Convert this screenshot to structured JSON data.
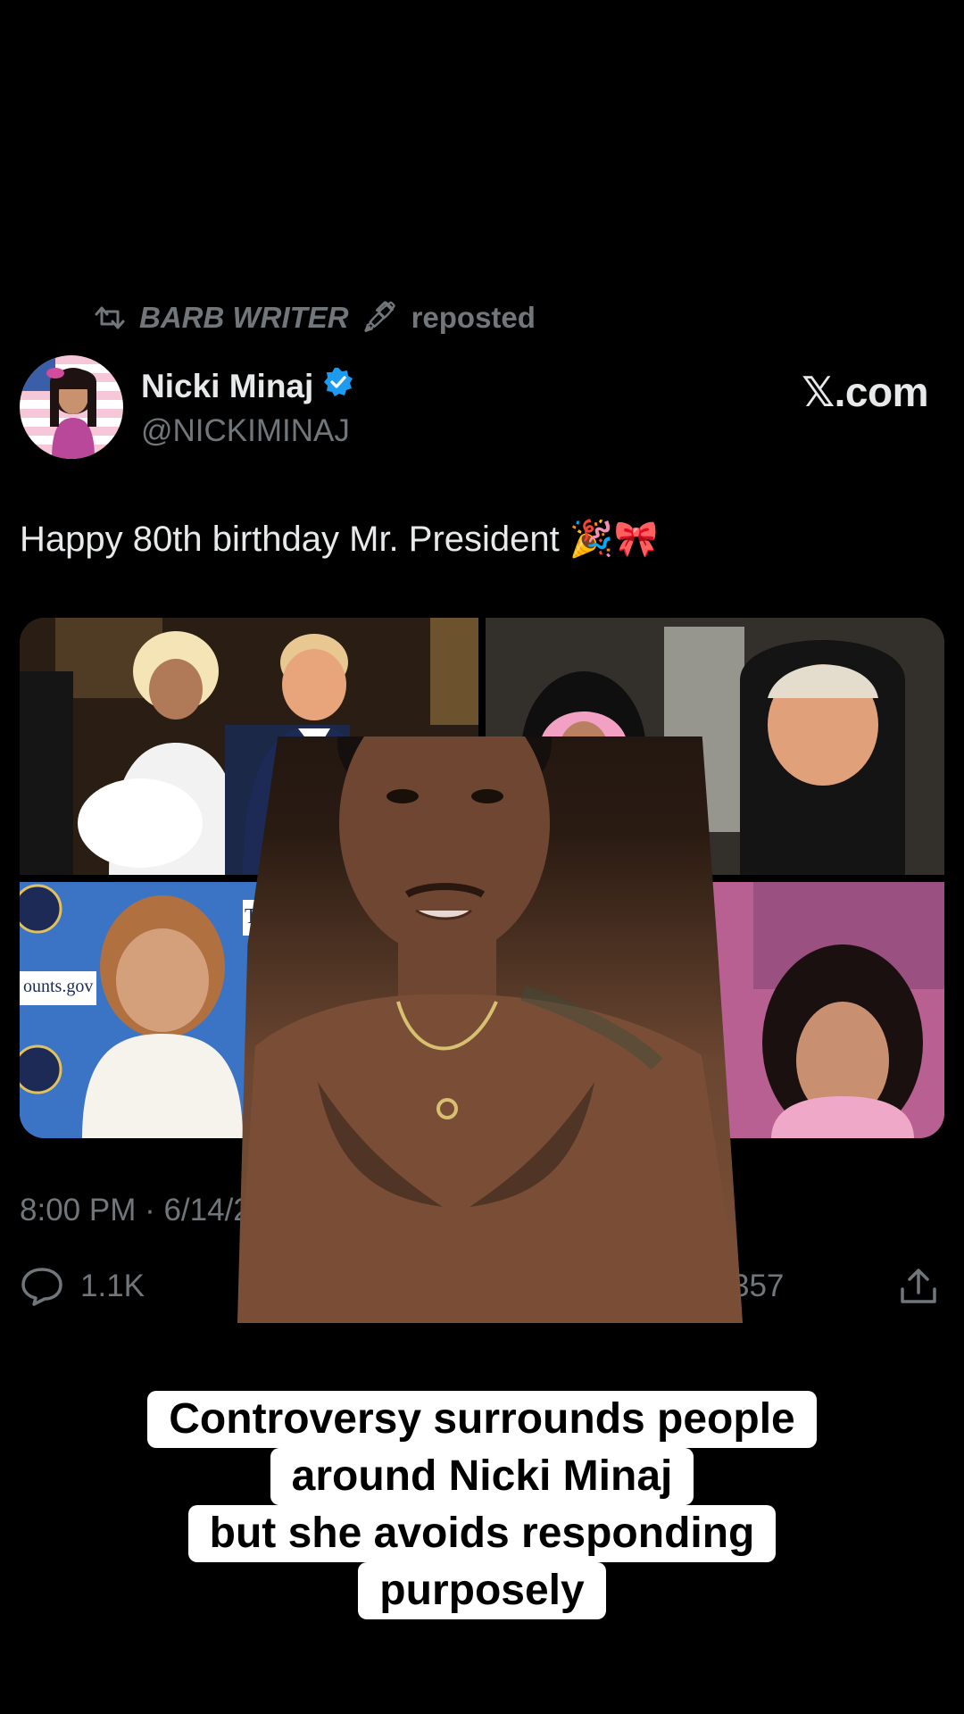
{
  "repost": {
    "reposter_name": "BARB WRITER",
    "reposter_emoji": "🖋",
    "action": "reposted",
    "icon": "repost-icon"
  },
  "author": {
    "name": "Nicki Minaj",
    "handle": "@NICKIMINAJ",
    "verified_icon": "verified-badge-icon",
    "verified_color": "#1d9bf0"
  },
  "site_label": "𝕏.com",
  "tweet": {
    "text": "Happy 80th birthday Mr. President 🎉🎀",
    "timestamp": "8:00 PM · 6/14/2"
  },
  "media": {
    "photo_1_sign": "Tru",
    "photo_3_sign": "ounts.gov"
  },
  "actions": {
    "reply_count": "1.1K",
    "bookmark_count": "357",
    "icons": [
      "reply-icon",
      "bookmark-icon",
      "share-icon"
    ]
  },
  "caption": {
    "lines": [
      "Controversy surrounds people",
      "around Nicki Minaj",
      "but she avoids responding",
      "purposely"
    ]
  },
  "colors": {
    "background": "#000000",
    "text_primary": "#e7e9ea",
    "text_secondary": "#71767b",
    "caption_bg": "#ffffff",
    "caption_text": "#000000"
  }
}
